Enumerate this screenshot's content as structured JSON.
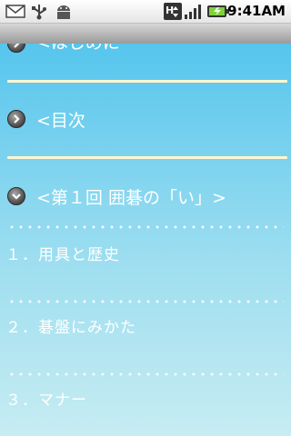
{
  "status_bar": {
    "time": "9:41AM",
    "icons": [
      "mail-icon",
      "usb-icon",
      "android-debug-icon",
      "hsdpa-data-icon",
      "signal-strength-icon",
      "battery-charging-icon"
    ]
  },
  "menu": {
    "partial_item": "<はじめに",
    "items": [
      {
        "label": "<目次",
        "state": "collapsed",
        "icon": "chevron-right-icon"
      },
      {
        "label": "<第１回 囲碁の「い」>",
        "state": "expanded",
        "icon": "chevron-down-icon"
      }
    ],
    "subitems": [
      {
        "label": "１．用具と歴史"
      },
      {
        "label": "２．碁盤にみかた"
      },
      {
        "label": "３．マナー"
      }
    ]
  },
  "colors": {
    "background_top": "#56c5ed",
    "background_bottom": "#c7ecf2",
    "separator": "#fff7cf",
    "text": "#ffffff"
  }
}
